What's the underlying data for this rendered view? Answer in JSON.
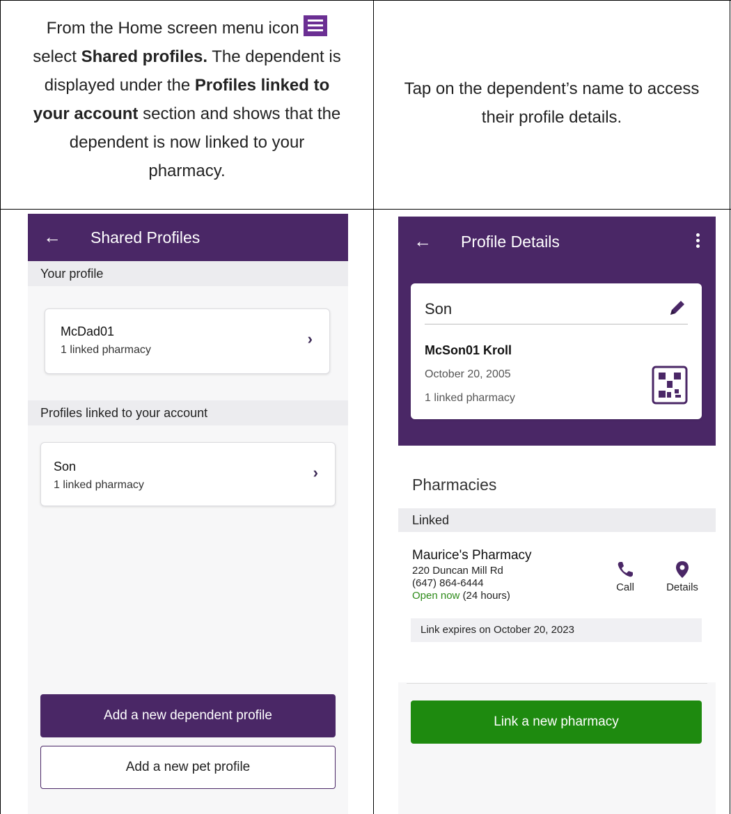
{
  "instructions": {
    "left": {
      "line1_prefix": "From the Home screen menu icon",
      "line2_prefix": "select",
      "line2_bold": "Shared profiles.",
      "line2_suffix": "The dependent is",
      "line3_prefix": "displayed under the",
      "line3_bold": "Profiles linked to",
      "line4_bold": "your account",
      "line4_suffix": "section and shows that the",
      "line5": "dependent is now linked to your",
      "line6": "pharmacy."
    },
    "right": {
      "line1": "Tap on the dependent’s name to access",
      "line2": "their profile details."
    }
  },
  "shared_profiles": {
    "title": "Shared Profiles",
    "your_profile_header": "Your profile",
    "your_profile_card": {
      "name": "McDad01",
      "sub": "1 linked pharmacy"
    },
    "linked_header": "Profiles linked to your account",
    "linked_card": {
      "name": "Son",
      "sub": "1 linked pharmacy"
    },
    "add_dependent_label": "Add a new dependent profile",
    "add_pet_label": "Add a new pet profile"
  },
  "profile_details": {
    "title": "Profile Details",
    "card_title": "Son",
    "full_name": "McSon01 Kroll",
    "dob": "October 20, 2005",
    "linked_count": "1 linked pharmacy",
    "pharmacies_heading": "Pharmacies",
    "linked_header": "Linked",
    "pharmacy": {
      "name": "Maurice's Pharmacy",
      "address": "220 Duncan Mill Rd",
      "phone": "(647) 864-6444",
      "open_status": "Open now",
      "hours": "(24 hours)",
      "call_label": "Call",
      "details_label": "Details"
    },
    "link_expiry": "Link expires on October 20, 2023",
    "link_new_label": "Link a new pharmacy"
  },
  "colors": {
    "brand_purple": "#4a2766",
    "menu_icon_purple": "#6b2f93",
    "open_green": "#2e8b1a",
    "button_green": "#1e8a0f"
  }
}
